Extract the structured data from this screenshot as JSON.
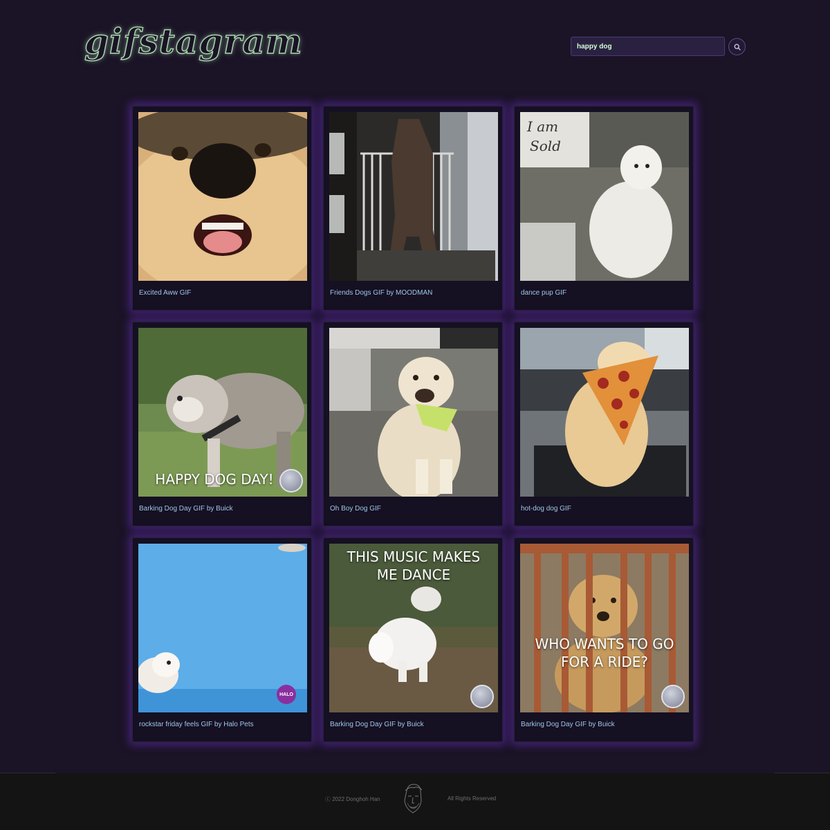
{
  "header": {
    "logo": "gifstagram",
    "search": {
      "value": "happy dog",
      "placeholder": ""
    },
    "search_icon": "search-icon"
  },
  "gifs": [
    {
      "caption": "Excited Aww GIF",
      "overlay": ""
    },
    {
      "caption": "Friends Dogs GIF by MOODMAN",
      "overlay": ""
    },
    {
      "caption": "dance pup GIF",
      "overlay": "I am Sold"
    },
    {
      "caption": "Barking Dog Day GIF by Buick",
      "overlay": "HAPPY DOG DAY!"
    },
    {
      "caption": "Oh Boy Dog GIF",
      "overlay": ""
    },
    {
      "caption": "hot-dog dog GIF",
      "overlay": ""
    },
    {
      "caption": "rockstar friday feels GIF by Halo Pets",
      "overlay": "HALO"
    },
    {
      "caption": "Barking Dog Day GIF by Buick",
      "overlay": "THIS MUSIC MAKES ME DANCE"
    },
    {
      "caption": "Barking Dog Day GIF by Buick",
      "overlay": "WHO WANTS TO GO FOR A RIDE?"
    }
  ],
  "footer": {
    "copyright": "ⓒ 2022 Donghoh Han",
    "rights": "All Rights Reserved",
    "face_icon": "author-face-icon"
  },
  "colors": {
    "background": "#1b1326",
    "card_glow": "#6e32c8",
    "caption": "#9fc7e6",
    "logo_outline": "#a8d4ad"
  }
}
